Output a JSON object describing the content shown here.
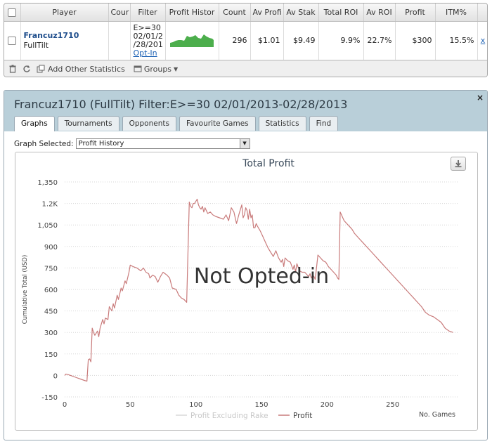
{
  "stats": {
    "headers": [
      "Player",
      "Cour",
      "Filter",
      "Profit Histor",
      "Count",
      "Av Profi",
      "Av Stak",
      "Total ROI",
      "Av ROI",
      "Profit",
      "ITM%"
    ],
    "row": {
      "player": "Francuz1710",
      "site": "FullTilt",
      "filter_lines": [
        "E>=30",
        "02/01/2",
        "/28/201"
      ],
      "optin": "Opt-In",
      "count": "296",
      "av_profit": "$1.01",
      "av_stake": "$9.49",
      "total_roi": "9.9%",
      "av_roi": "22.7%",
      "profit": "$300",
      "itm": "15.5%",
      "remove": "x"
    },
    "toolbar": {
      "add_stats": "Add Other Statistics",
      "groups": "Groups"
    }
  },
  "window": {
    "title": "Francuz1710 (FullTilt) Filter:E>=30 02/01/2013-02/28/2013",
    "close": "×",
    "tabs": [
      "Graphs",
      "Tournaments",
      "Opponents",
      "Favourite Games",
      "Statistics",
      "Find"
    ],
    "active_tab": "Graphs",
    "graph_select_label": "Graph Selected:",
    "graph_select_value": "Profit History"
  },
  "chart_data": {
    "type": "line",
    "title": "Total Profit",
    "ylabel": "Cumulative Total (USD)",
    "xlabel": "No. Games",
    "overlay": "Not Opted-in",
    "ylim": [
      -150,
      1350
    ],
    "xlim": [
      0,
      300
    ],
    "yticks": [
      -150,
      0,
      150,
      300,
      450,
      600,
      750,
      900,
      1050,
      1200,
      1350
    ],
    "ytick_labels": [
      "-150",
      "0",
      "150",
      "300",
      "450",
      "600",
      "750",
      "900",
      "1,050",
      "1.2K",
      "1,350"
    ],
    "xticks": [
      0,
      50,
      100,
      150,
      200,
      250
    ],
    "grid": true,
    "legend": {
      "placement": "bottom-center",
      "entries": [
        "Profit Excluding Rake",
        "Profit"
      ]
    },
    "series": [
      {
        "name": "Profit",
        "color": "#c97b7b",
        "x": [
          0,
          1,
          3,
          6,
          9,
          12,
          15,
          17,
          18,
          19,
          20,
          21,
          22,
          23,
          25,
          26,
          27,
          29,
          30,
          31,
          33,
          34,
          36,
          37,
          38,
          40,
          41,
          43,
          44,
          46,
          47,
          49,
          50,
          52,
          55,
          58,
          60,
          62,
          64,
          65,
          67,
          69,
          71,
          73,
          75,
          78,
          80,
          82,
          85,
          87,
          89,
          91,
          93,
          95,
          96,
          97,
          98,
          99,
          101,
          102,
          103,
          104,
          105,
          106,
          107,
          109,
          111,
          113,
          115,
          118,
          121,
          123,
          125,
          127,
          129,
          131,
          133,
          135,
          136,
          137,
          138,
          139,
          140,
          141,
          142,
          143,
          144,
          145,
          146,
          147,
          149,
          151,
          153,
          155,
          157,
          159,
          161,
          163,
          165,
          166,
          167,
          168,
          170,
          172,
          174,
          175,
          176,
          177,
          179,
          181,
          183,
          185,
          186,
          187,
          188,
          189,
          190,
          191,
          193,
          195,
          197,
          199,
          201,
          203,
          205,
          207,
          208,
          209,
          210,
          211,
          212,
          213,
          215,
          217,
          219,
          221,
          224,
          227,
          230,
          233,
          236,
          239,
          242,
          245,
          248,
          251,
          254,
          257,
          260,
          263,
          266,
          269,
          272,
          275,
          278,
          281,
          284,
          287,
          290,
          293,
          296
        ],
        "y": [
          0,
          10,
          5,
          -5,
          -15,
          -25,
          -35,
          -40,
          110,
          115,
          95,
          330,
          300,
          280,
          310,
          270,
          330,
          390,
          360,
          400,
          390,
          480,
          450,
          500,
          470,
          560,
          530,
          610,
          590,
          660,
          640,
          720,
          770,
          760,
          750,
          730,
          750,
          720,
          710,
          680,
          700,
          690,
          650,
          690,
          720,
          700,
          680,
          610,
          600,
          560,
          540,
          530,
          510,
          1210,
          1180,
          1170,
          1200,
          1200,
          1230,
          1190,
          1170,
          1160,
          1180,
          1140,
          1170,
          1130,
          1140,
          1120,
          1110,
          1100,
          1090,
          1120,
          1080,
          1170,
          1140,
          1060,
          1130,
          1190,
          1100,
          1120,
          1170,
          1150,
          1090,
          1160,
          1100,
          1120,
          1030,
          1030,
          1060,
          1040,
          1010,
          970,
          930,
          890,
          860,
          830,
          870,
          820,
          790,
          810,
          760,
          820,
          800,
          790,
          740,
          770,
          720,
          780,
          730,
          720,
          720,
          700,
          690,
          710,
          680,
          700,
          690,
          670,
          840,
          820,
          800,
          790,
          760,
          740,
          720,
          700,
          680,
          670,
          1140,
          1120,
          1100,
          1080,
          1060,
          1040,
          1020,
          990,
          960,
          930,
          900,
          870,
          840,
          810,
          780,
          750,
          720,
          690,
          660,
          630,
          600,
          570,
          540,
          510,
          480,
          440,
          420,
          410,
          390,
          370,
          330,
          310,
          300
        ]
      }
    ]
  }
}
